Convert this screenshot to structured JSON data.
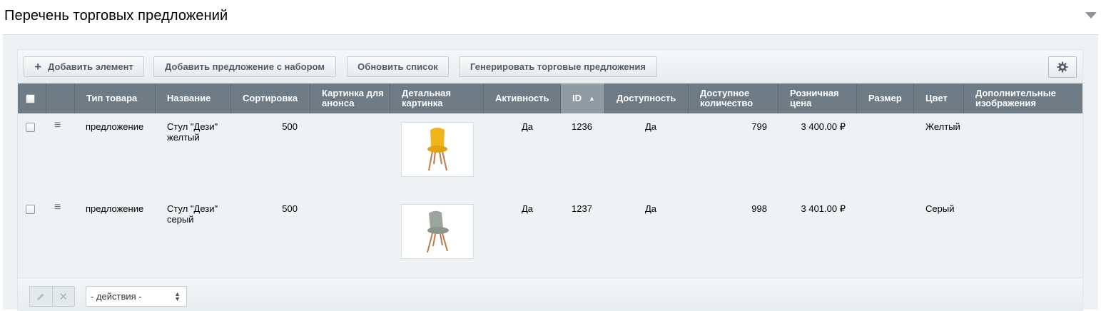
{
  "page": {
    "title": "Перечень торговых предложений"
  },
  "toolbar": {
    "add_element": "Добавить элемент",
    "add_offer_with_set": "Добавить предложение с набором",
    "refresh_list": "Обновить список",
    "generate_offers": "Генерировать торговые предложения",
    "settings_icon": "gear-icon"
  },
  "table": {
    "columns": [
      "Тип товара",
      "Название",
      "Сортировка",
      "Картинка для анонса",
      "Детальная картинка",
      "Активность",
      "ID",
      "Доступность",
      "Доступное количество",
      "Розничная цена",
      "Размер",
      "Цвет",
      "Дополнительные изображения"
    ],
    "sorted_column": "ID",
    "sort_direction": "asc",
    "rows": [
      {
        "type": "предложение",
        "name": "Стул \"Дези\" желтый",
        "sort": "500",
        "active": "Да",
        "id": "1236",
        "availability": "Да",
        "quantity": "799",
        "price": "3 400.00 ₽",
        "size": "",
        "color": "Желтый",
        "image_color": "#f1b51c"
      },
      {
        "type": "предложение",
        "name": "Стул \"Дези\" серый",
        "sort": "500",
        "active": "Да",
        "id": "1237",
        "availability": "Да",
        "quantity": "998",
        "price": "3 401.00 ₽",
        "size": "",
        "color": "Серый",
        "image_color": "#9aa69c"
      }
    ]
  },
  "footer": {
    "actions_select": "- действия -"
  },
  "colors": {
    "header_bg": "#707c85",
    "sorted_header_bg": "#909ba3",
    "row_bg": "#eef2f4"
  }
}
